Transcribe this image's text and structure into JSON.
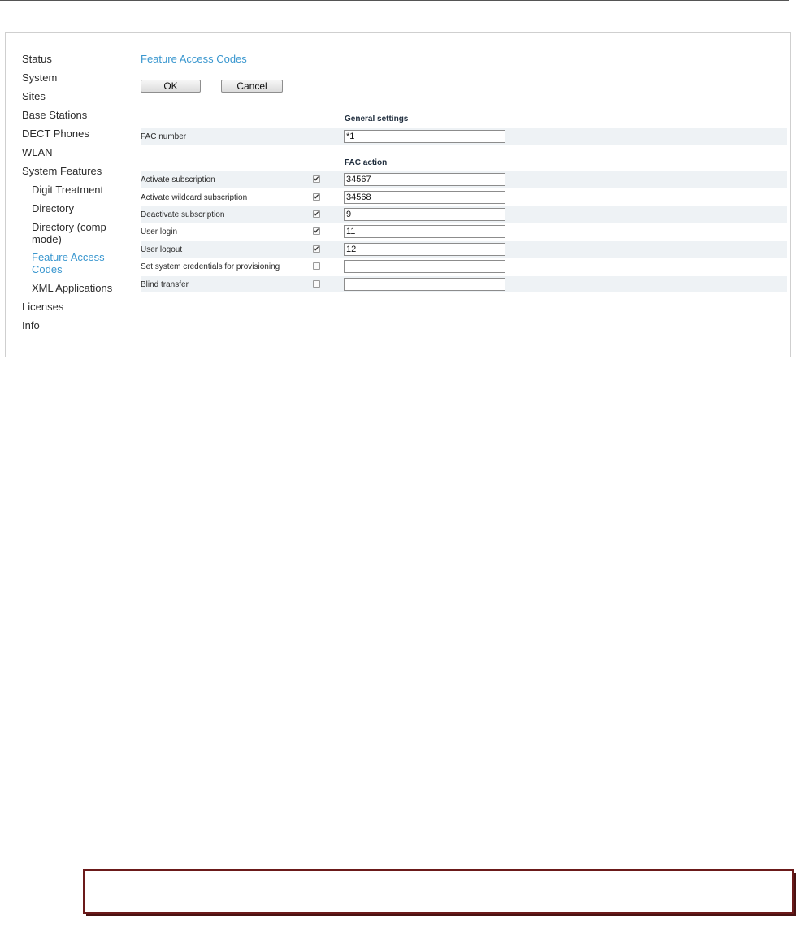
{
  "sidebar": {
    "items": [
      {
        "label": "Status"
      },
      {
        "label": "System"
      },
      {
        "label": "Sites"
      },
      {
        "label": "Base Stations"
      },
      {
        "label": "DECT Phones"
      },
      {
        "label": "WLAN"
      },
      {
        "label": "System Features"
      },
      {
        "label": "Digit Treatment"
      },
      {
        "label": "Directory"
      },
      {
        "label": "Directory (comp\nmode)"
      },
      {
        "label": "Feature Access\nCodes"
      },
      {
        "label": "XML Applications"
      },
      {
        "label": "Licenses"
      },
      {
        "label": "Info"
      }
    ]
  },
  "page": {
    "title": "Feature Access Codes",
    "ok_label": "OK",
    "cancel_label": "Cancel"
  },
  "general": {
    "header": "General settings",
    "fac_number_label": "FAC number",
    "fac_number_value": "*1"
  },
  "actions": {
    "header": "FAC action",
    "rows": [
      {
        "label": "Activate subscription",
        "checked": true,
        "value": "34567"
      },
      {
        "label": "Activate wildcard subscription",
        "checked": true,
        "value": "34568"
      },
      {
        "label": "Deactivate subscription",
        "checked": true,
        "value": "9"
      },
      {
        "label": "User login",
        "checked": true,
        "value": "11"
      },
      {
        "label": "User logout",
        "checked": true,
        "value": "12"
      },
      {
        "label": "Set system credentials for provisioning",
        "checked": false,
        "value": ""
      },
      {
        "label": "Blind transfer",
        "checked": false,
        "value": ""
      }
    ]
  },
  "colors": {
    "accent": "#3a97cf",
    "row_shade": "#eef2f5",
    "alert_border": "#6b1a1a"
  }
}
